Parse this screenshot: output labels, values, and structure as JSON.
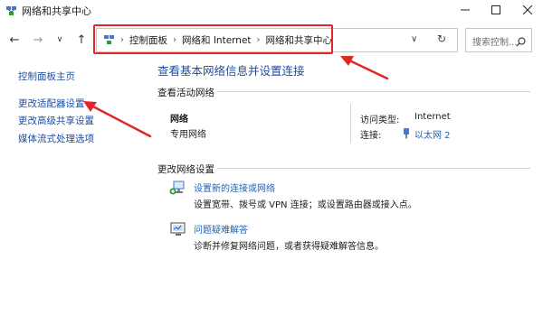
{
  "window": {
    "title": "网络和共享中心"
  },
  "nav": {
    "back": "←",
    "forward": "→",
    "recent": "∨",
    "up": "↑"
  },
  "address": {
    "crumbs": [
      "控制面板",
      "网络和 Internet",
      "网络和共享中心"
    ],
    "dropdown": "∨",
    "refresh": "↻"
  },
  "search": {
    "placeholder": "搜索控制..."
  },
  "sidebar": {
    "items": [
      {
        "label": "控制面板主页"
      },
      {
        "label": "更改适配器设置"
      },
      {
        "label": "更改高级共享设置"
      },
      {
        "label": "媒体流式处理选项"
      }
    ]
  },
  "main": {
    "title": "查看基本网络信息并设置连接",
    "active_heading": "查看活动网络",
    "network": {
      "name": "网络",
      "type": "专用网络",
      "access_label": "访问类型:",
      "access_value": "Internet",
      "conn_label": "连接:",
      "conn_value": "以太网 2"
    },
    "change_heading": "更改网络设置",
    "tasks": [
      {
        "title": "设置新的连接或网络",
        "desc": "设置宽带、拨号或 VPN 连接；或设置路由器或接入点。",
        "icon": "network-setup-icon"
      },
      {
        "title": "问题疑难解答",
        "desc": "诊断并修复网络问题，或者获得疑难解答信息。",
        "icon": "troubleshoot-icon"
      }
    ]
  },
  "colors": {
    "annotation": "#e32727",
    "link": "#1f4e9e"
  }
}
